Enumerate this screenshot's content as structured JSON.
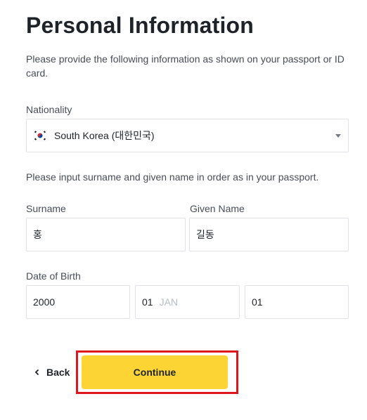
{
  "page": {
    "title": "Personal Information",
    "intro": "Please provide the following information as shown on your passport or ID card."
  },
  "nationality": {
    "label": "Nationality",
    "value": "South Korea (대한민국)",
    "flag_icon": "south-korea-flag-icon"
  },
  "name_section": {
    "instruction": "Please input surname and given name in order as in your passport.",
    "surname_label": "Surname",
    "surname_value": "홍",
    "given_name_label": "Given Name",
    "given_name_value": "길동"
  },
  "date_of_birth": {
    "label": "Date of Birth",
    "year": "2000",
    "month": "01",
    "month_hint": "JAN",
    "day": "01"
  },
  "actions": {
    "back_label": "Back",
    "continue_label": "Continue"
  },
  "colors": {
    "primary_button": "#fcd535",
    "highlight_border": "#e0161e",
    "text": "#1e2329",
    "muted_text": "#474d57",
    "field_border": "#e0e3e8"
  }
}
